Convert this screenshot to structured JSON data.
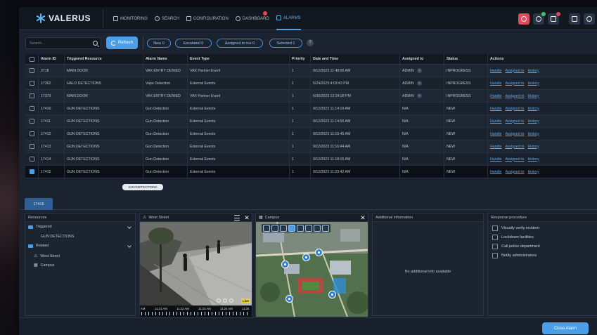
{
  "header": {
    "logo_text": "VALERUS",
    "nav": [
      {
        "label": "MONITORING",
        "icon": "monitor-icon",
        "active": false
      },
      {
        "label": "SEARCH",
        "icon": "search-icon",
        "active": false
      },
      {
        "label": "CONFIGURATION",
        "icon": "hierarchy-icon",
        "active": false
      },
      {
        "label": "DASHBOARD",
        "icon": "gauge-icon",
        "active": false,
        "badge": true
      },
      {
        "label": "ALARMS",
        "icon": "shield-icon",
        "active": true
      }
    ],
    "right_icons": [
      "alarm-bell-icon",
      "eye-notification-icon",
      "export-icon",
      "tools-icon",
      "user-icon"
    ]
  },
  "toolbar": {
    "search_placeholder": "Search...",
    "refresh_label": "Refresh",
    "filters": [
      "New 0",
      "Escalated 0",
      "Assigned to me 0",
      "Selected 1"
    ],
    "help": "?"
  },
  "table": {
    "columns": [
      "",
      "Alarm ID",
      "Triggered Resource",
      "Alarm Name",
      "Event Type",
      "Priority",
      "Date and Time",
      "Assigned to",
      "Status",
      "Actions"
    ],
    "rows": [
      {
        "id": "3718",
        "resource": "MAIN DOOR",
        "name": "VAX ENTRY DENIED",
        "event": "VAX Partner Event",
        "priority": "1",
        "datetime": "9/12/2023 11:48:06 AM",
        "assigned": "ADMIN",
        "status": "INPROGRESS",
        "checked": false
      },
      {
        "id": "17362",
        "resource": "HALO DETECTIONS",
        "name": "Vape Detection",
        "event": "External Events",
        "priority": "1",
        "datetime": "5/24/2023 4:03:43 PM",
        "assigned": "ADMIN",
        "status": "INPROGRESS",
        "checked": false
      },
      {
        "id": "17379",
        "resource": "MAIN DOOR",
        "name": "VAX ENTRY DENIED",
        "event": "VAX Partner Event",
        "priority": "1",
        "datetime": "6/30/2023 12:24:28 PM",
        "assigned": "ADMIN",
        "status": "INPROGRESS",
        "checked": false
      },
      {
        "id": "17410",
        "resource": "GUN DETECTIONS",
        "name": "Gun Detection",
        "event": "External Events",
        "priority": "1",
        "datetime": "9/12/2023 11:14:19 AM",
        "assigned": "N/A",
        "status": "NEW",
        "checked": false
      },
      {
        "id": "17411",
        "resource": "GUN DETECTIONS",
        "name": "Gun Detection",
        "event": "External Events",
        "priority": "1",
        "datetime": "9/12/2023 11:14:56 AM",
        "assigned": "N/A",
        "status": "NEW",
        "checked": false
      },
      {
        "id": "17412",
        "resource": "GUN DETECTIONS",
        "name": "Gun Detection",
        "event": "External Events",
        "priority": "1",
        "datetime": "9/12/2023 11:15:45 AM",
        "assigned": "N/A",
        "status": "NEW",
        "checked": false
      },
      {
        "id": "17413",
        "resource": "GUN DETECTIONS",
        "name": "Gun Detection",
        "event": "External Events",
        "priority": "1",
        "datetime": "9/12/2023 11:16:44 AM",
        "assigned": "N/A",
        "status": "NEW",
        "checked": false
      },
      {
        "id": "17414",
        "resource": "GUN DETECTIONS",
        "name": "Gun Detection",
        "event": "External Events",
        "priority": "1",
        "datetime": "9/12/2023 11:18:15 AM",
        "assigned": "N/A",
        "status": "NEW",
        "checked": false
      },
      {
        "id": "17415",
        "resource": "GUN DETECTIONS",
        "name": "Gun Detection",
        "event": "External Events",
        "priority": "1",
        "datetime": "9/12/2023 11:23:42 AM",
        "assigned": "N/A",
        "status": "NEW",
        "checked": true
      }
    ],
    "actions": [
      "Handle",
      "Assigned to",
      "History"
    ],
    "tooltip": "GUN DETECTIONS"
  },
  "detail": {
    "tab_label": "17415",
    "resources": {
      "title": "Resources",
      "triggered_label": "Triggered",
      "triggered_item": "GUN DETECTIONS",
      "related_label": "Related",
      "related_items": [
        "West Street",
        "Campus"
      ]
    },
    "camera": {
      "title": "West Street",
      "timeline_labels": [
        "AM",
        "11:21 AM",
        "11:22 AM",
        "11:23 AM",
        "11:24 AM",
        "11:25"
      ],
      "live_label": "Live"
    },
    "map": {
      "title": "Campus"
    },
    "additional": {
      "title": "Additional information",
      "empty_text": "No additional info available"
    },
    "procedure": {
      "title": "Response procedure",
      "steps": [
        "Visually verify incident",
        "Lockdown facilities",
        "Call police department",
        "Notify administrators"
      ]
    }
  },
  "footer": {
    "close_label": "Close Alarm"
  },
  "colors": {
    "accent": "#4a9fe8",
    "header_bg": "#121820",
    "alert": "#e04a5c"
  }
}
